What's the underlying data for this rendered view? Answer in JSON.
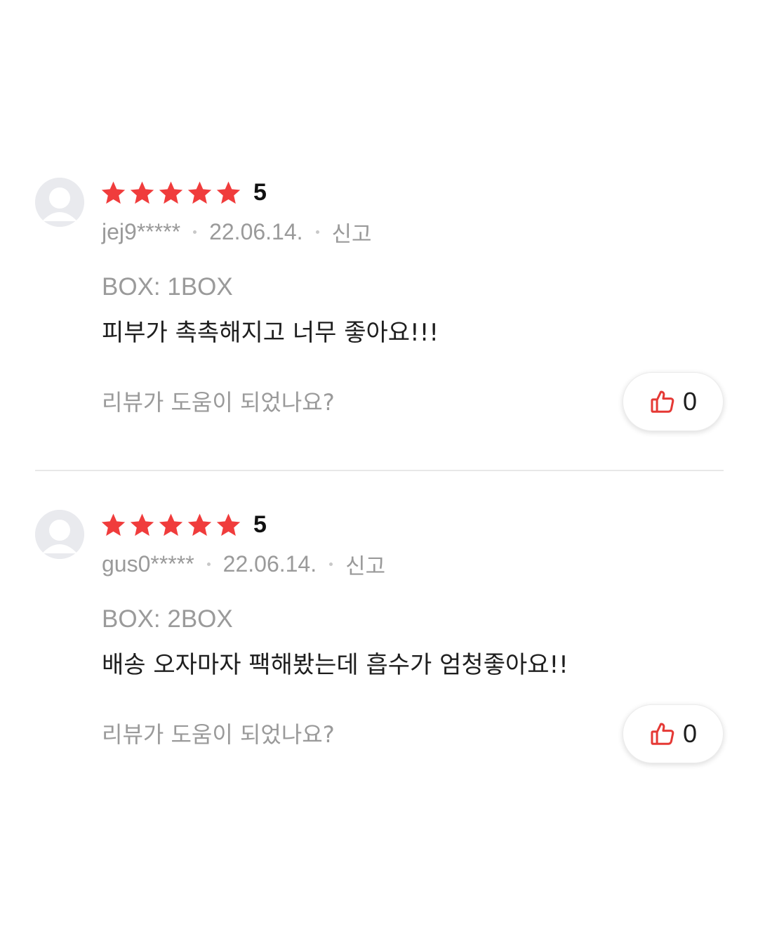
{
  "colors": {
    "star": "#f03c3c",
    "thumb": "#e53935",
    "muted_text": "#9a9a9a",
    "body_text": "#1e1e1e",
    "divider": "#e8e8e8"
  },
  "reviews": [
    {
      "rating": "5",
      "stars_filled": 5,
      "user": "jej9*****",
      "date": "22.06.14.",
      "report_label": "신고",
      "option": "BOX: 1BOX",
      "text": "피부가 촉촉해지고 너무 좋아요!!!",
      "helpful_prompt": "리뷰가 도움이 되었나요?",
      "like_count": "0",
      "icons": {
        "avatar": "user-avatar-icon",
        "star": "star-icon",
        "like": "thumbs-up-icon"
      }
    },
    {
      "rating": "5",
      "stars_filled": 5,
      "user": "gus0*****",
      "date": "22.06.14.",
      "report_label": "신고",
      "option": "BOX: 2BOX",
      "text": "배송 오자마자 팩해봤는데 흡수가 엄청좋아요!!",
      "helpful_prompt": "리뷰가 도움이 되었나요?",
      "like_count": "0",
      "icons": {
        "avatar": "user-avatar-icon",
        "star": "star-icon",
        "like": "thumbs-up-icon"
      }
    }
  ]
}
